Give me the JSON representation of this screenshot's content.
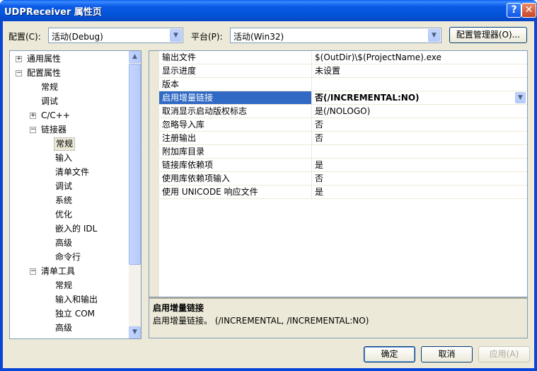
{
  "window": {
    "title": "UDPReceiver 属性页",
    "help_label": "?",
    "close_label": "✕"
  },
  "toolbar": {
    "config_label": "配置(C):",
    "config_value": "活动(Debug)",
    "platform_label": "平台(P):",
    "platform_value": "活动(Win32)",
    "config_manager_label": "配置管理器(O)..."
  },
  "tree": [
    {
      "label": "通用属性",
      "level": 0,
      "expander": "+"
    },
    {
      "label": "配置属性",
      "level": 0,
      "expander": "−"
    },
    {
      "label": "常规",
      "level": 1
    },
    {
      "label": "调试",
      "level": 1
    },
    {
      "label": "C/C++",
      "level": 1,
      "expander": "+"
    },
    {
      "label": "链接器",
      "level": 1,
      "expander": "−"
    },
    {
      "label": "常规",
      "level": 2,
      "selected": true
    },
    {
      "label": "输入",
      "level": 2
    },
    {
      "label": "清单文件",
      "level": 2
    },
    {
      "label": "调试",
      "level": 2
    },
    {
      "label": "系统",
      "level": 2
    },
    {
      "label": "优化",
      "level": 2
    },
    {
      "label": "嵌入的 IDL",
      "level": 2
    },
    {
      "label": "高级",
      "level": 2
    },
    {
      "label": "命令行",
      "level": 2
    },
    {
      "label": "清单工具",
      "level": 1,
      "expander": "−"
    },
    {
      "label": "常规",
      "level": 2
    },
    {
      "label": "输入和输出",
      "level": 2
    },
    {
      "label": "独立 COM",
      "level": 2
    },
    {
      "label": "高级",
      "level": 2
    }
  ],
  "properties": [
    {
      "name": "输出文件",
      "value": "$(OutDir)\\$(ProjectName).exe"
    },
    {
      "name": "显示进度",
      "value": "未设置"
    },
    {
      "name": "版本",
      "value": ""
    },
    {
      "name": "启用增量链接",
      "value": "否(/INCREMENTAL:NO)",
      "selected": true
    },
    {
      "name": "取消显示启动版权标志",
      "value": "是(/NOLOGO)"
    },
    {
      "name": "忽略导入库",
      "value": "否"
    },
    {
      "name": "注册输出",
      "value": "否"
    },
    {
      "name": "附加库目录",
      "value": ""
    },
    {
      "name": "链接库依赖项",
      "value": "是"
    },
    {
      "name": "使用库依赖项输入",
      "value": "否"
    },
    {
      "name": "使用 UNICODE 响应文件",
      "value": "是"
    }
  ],
  "description": {
    "title": "启用增量链接",
    "text": "启用增量链接。      (/INCREMENTAL, /INCREMENTAL:NO)"
  },
  "buttons": {
    "ok": "确定",
    "cancel": "取消",
    "apply": "应用(A)"
  },
  "colors": {
    "titlebar": "#0454d8",
    "selection": "#316ac5",
    "dialog_bg": "#ece9d8"
  }
}
